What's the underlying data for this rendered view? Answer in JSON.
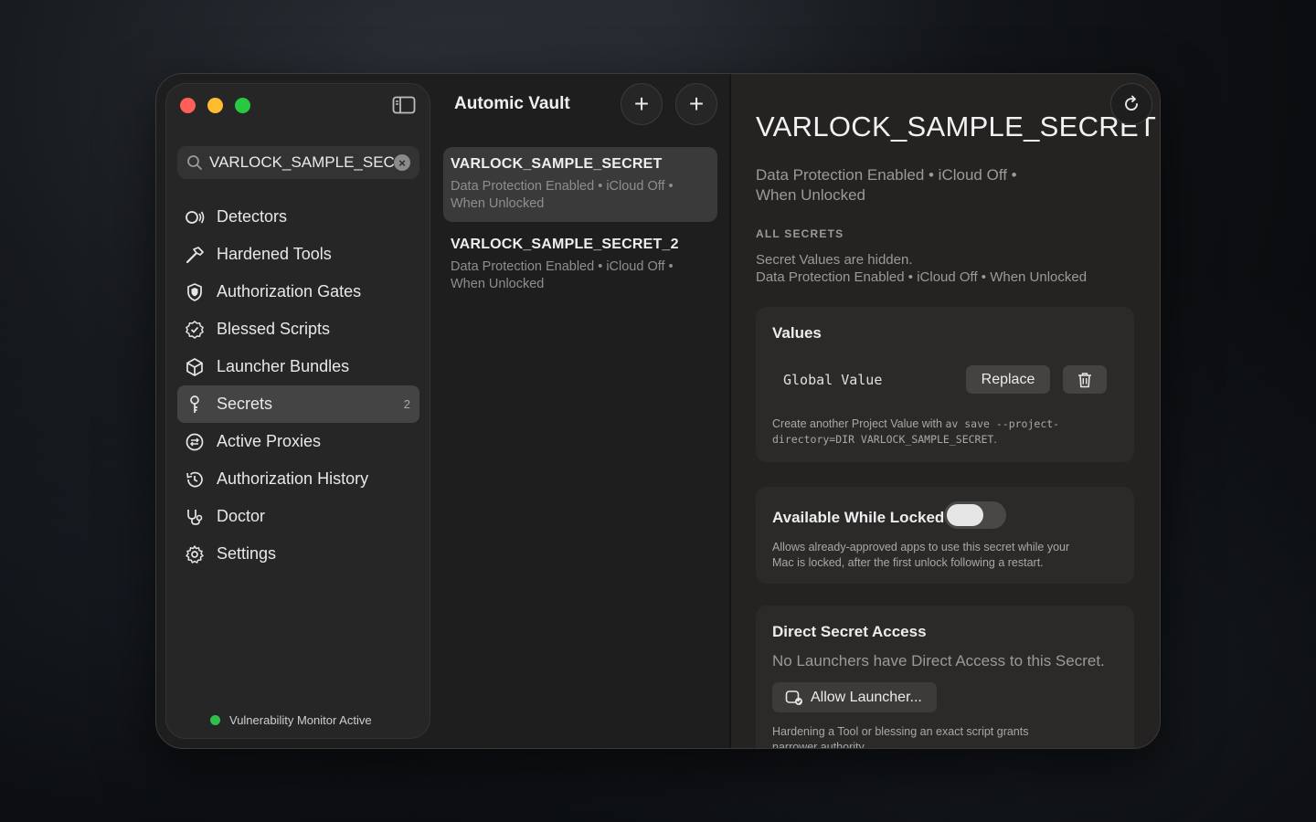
{
  "sidebar": {
    "search_value": "VARLOCK_SAMPLE_SEC",
    "items": [
      {
        "label": "Detectors",
        "icon": "detector-icon",
        "count": ""
      },
      {
        "label": "Hardened Tools",
        "icon": "hammer-icon",
        "count": ""
      },
      {
        "label": "Authorization Gates",
        "icon": "shield-icon",
        "count": ""
      },
      {
        "label": "Blessed Scripts",
        "icon": "seal-check-icon",
        "count": ""
      },
      {
        "label": "Launcher Bundles",
        "icon": "cube-icon",
        "count": ""
      },
      {
        "label": "Secrets",
        "icon": "key-icon",
        "count": "2",
        "active": true
      },
      {
        "label": "Active Proxies",
        "icon": "proxy-icon",
        "count": ""
      },
      {
        "label": "Authorization History",
        "icon": "history-icon",
        "count": ""
      },
      {
        "label": "Doctor",
        "icon": "stethoscope-icon",
        "count": ""
      },
      {
        "label": "Settings",
        "icon": "gear-icon",
        "count": ""
      }
    ],
    "monitor_status": "Vulnerability Monitor Active"
  },
  "middle": {
    "title": "Automic Vault",
    "secrets": [
      {
        "name": "VARLOCK_SAMPLE_SECRET",
        "meta_line1": "Data Protection Enabled • iCloud Off •",
        "meta_line2": "When Unlocked",
        "selected": true
      },
      {
        "name": "VARLOCK_SAMPLE_SECRET_2",
        "meta_line1": "Data Protection Enabled • iCloud Off •",
        "meta_line2": "When Unlocked",
        "selected": false
      }
    ]
  },
  "detail": {
    "title": "VARLOCK_SAMPLE_SECRET",
    "meta_line1": "Data Protection Enabled • iCloud Off •",
    "meta_line2": "When Unlocked",
    "all_secrets_label": "ALL SECRETS",
    "hidden_line1": "Secret Values are hidden.",
    "hidden_line2": "Data Protection Enabled • iCloud Off • When Unlocked",
    "values": {
      "heading": "Values",
      "global_label": "Global Value",
      "replace_label": "Replace",
      "hint_prefix": "Create another Project Value with",
      "hint_cmd1": "av save --project-",
      "hint_cmd2": "directory=DIR VARLOCK_SAMPLE_SECRET",
      "hint_suffix": "."
    },
    "locked": {
      "heading": "Available While Locked",
      "enabled": false,
      "hint_line1": "Allows already-approved apps to use this secret while your",
      "hint_line2": "Mac is locked, after the first unlock following a restart."
    },
    "direct": {
      "heading": "Direct Secret Access",
      "empty_text": "No Launchers have Direct Access to this Secret.",
      "allow_label": "Allow Launcher...",
      "hint_line1": "Hardening a Tool or blessing an exact script grants",
      "hint_line2": "narrower authority."
    }
  },
  "colors": {
    "accent_green": "#28c840",
    "close_red": "#ff5f57",
    "minimize_yellow": "#febc2e"
  }
}
